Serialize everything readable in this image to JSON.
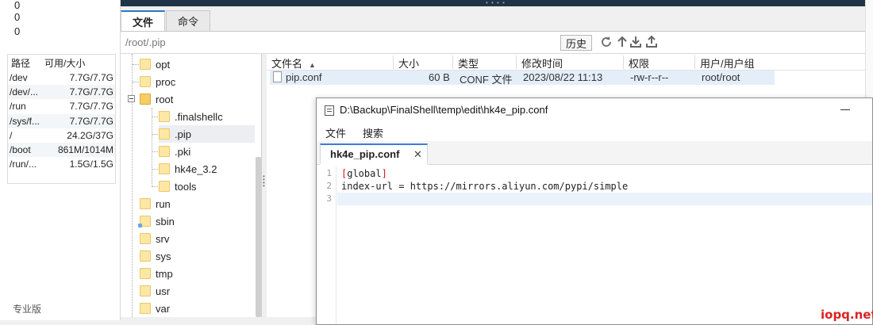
{
  "load": [
    "0",
    "0",
    "0"
  ],
  "disk": {
    "headers": [
      "路径",
      "可用/大小"
    ],
    "rows": [
      {
        "path": "/dev",
        "size": "7.7G/7.7G"
      },
      {
        "path": "/dev/...",
        "size": "7.7G/7.7G"
      },
      {
        "path": "/run",
        "size": "7.7G/7.7G"
      },
      {
        "path": "/sys/f...",
        "size": "7.7G/7.7G"
      },
      {
        "path": "/",
        "size": "24.2G/37G"
      },
      {
        "path": "/boot",
        "size": "861M/1014M"
      },
      {
        "path": "/run/...",
        "size": "1.5G/1.5G"
      }
    ]
  },
  "edition": "专业版",
  "tabs": [
    {
      "label": "文件",
      "active": true
    },
    {
      "label": "命令",
      "active": false
    }
  ],
  "path_bar": {
    "path": "/root/.pip",
    "history_label": "历史"
  },
  "toolbar_icons": [
    "refresh-icon",
    "upload-arrow-icon",
    "download-icon",
    "upload-icon"
  ],
  "tree": {
    "items": [
      {
        "name": "opt"
      },
      {
        "name": "proc"
      },
      {
        "name": "root"
      },
      {
        "name": ".finalshellc"
      },
      {
        "name": ".pip"
      },
      {
        "name": ".pki"
      },
      {
        "name": "hk4e_3.2"
      },
      {
        "name": "tools"
      },
      {
        "name": "run"
      },
      {
        "name": "sbin"
      },
      {
        "name": "srv"
      },
      {
        "name": "sys"
      },
      {
        "name": "tmp"
      },
      {
        "name": "usr"
      },
      {
        "name": "var"
      }
    ]
  },
  "file_list": {
    "headers": [
      "文件名",
      "大小",
      "类型",
      "修改时间",
      "权限",
      "用户/用户组"
    ],
    "rows": [
      {
        "name": "pip.conf",
        "size": "60 B",
        "type": "CONF 文件",
        "mtime": "2023/08/22 11:13",
        "perm": "-rw-r--r--",
        "owner": "root/root"
      }
    ]
  },
  "editor": {
    "title": "D:\\Backup\\FinalShell\\temp\\edit\\hk4e_pip.conf",
    "menu": [
      "文件",
      "搜索"
    ],
    "tab": "hk4e_pip.conf",
    "tab_close": "✕",
    "line_numbers": [
      "1",
      "2",
      "3"
    ],
    "lines": {
      "l1_open": "[",
      "l1_word": "global",
      "l1_close": "]",
      "l2": "index-url = https://mirrors.aliyun.com/pypi/simple",
      "l3": ""
    }
  },
  "watermark": "iopq.net",
  "colors": {
    "accent": "#2b78c5",
    "selection": "#e4eef8",
    "dark_strip": "#1f3447",
    "watermark": "#dd2222"
  }
}
